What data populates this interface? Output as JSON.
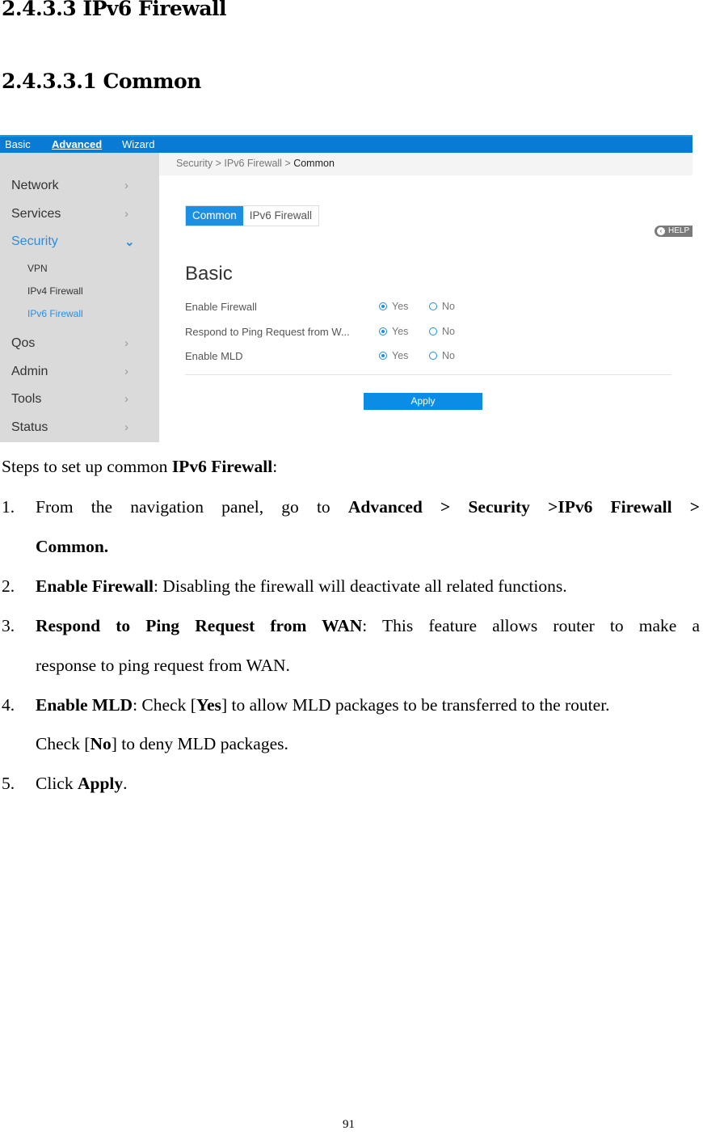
{
  "doc": {
    "heading1": "2.4.3.3 IPv6 Firewall",
    "heading2": "2.4.3.3.1 Common",
    "intro": {
      "prefix": "Steps to set up common ",
      "bold": "IPv6 Firewall",
      "suffix": ":"
    },
    "steps": [
      {
        "num": "1.",
        "line1": {
          "text": "From the navigation panel, go to ",
          "bold": "Advanced > Security >IPv6 Firewall >"
        },
        "line2_bold": "Common."
      },
      {
        "num": "2.",
        "bold": "Enable Firewall",
        "text": ": Disabling the firewall will deactivate all related functions."
      },
      {
        "num": "3.",
        "bold": "Respond to Ping Request from WAN",
        "text": ": This feature allows router to make a",
        "line2": "response to ping request from WAN."
      },
      {
        "num": "4.",
        "bold": "Enable MLD",
        "text_a": ": Check [",
        "bold_yes": "Yes",
        "text_b": "] to allow MLD packages to be transferred to the router.",
        "line2_a": "Check [",
        "bold_no": "No",
        "line2_b": "] to deny MLD packages."
      },
      {
        "num": "5.",
        "text": "Click ",
        "bold": "Apply",
        "suffix": "."
      }
    ],
    "page_number": "91"
  },
  "screenshot": {
    "topnav": [
      {
        "label": "Basic",
        "active": false
      },
      {
        "label": "Advanced",
        "active": true
      },
      {
        "label": "Wizard",
        "active": false
      }
    ],
    "breadcrumb": {
      "path": "Security > IPv6 Firewall > ",
      "current": "Common"
    },
    "sidebar": {
      "items": [
        {
          "label": "Network"
        },
        {
          "label": "Services"
        },
        {
          "label": "Security",
          "expanded": true
        },
        {
          "label": "Qos"
        },
        {
          "label": "Admin"
        },
        {
          "label": "Tools"
        },
        {
          "label": "Status"
        }
      ],
      "sub_items": [
        {
          "label": "VPN"
        },
        {
          "label": "IPv4 Firewall"
        },
        {
          "label": "IPv6 Firewall",
          "active": true
        }
      ]
    },
    "subtabs": [
      {
        "label": "Common",
        "active": true
      },
      {
        "label": "IPv6 Firewall",
        "active": false
      }
    ],
    "help_label": "HELP",
    "section_title": "Basic",
    "rows": [
      {
        "label": "Enable Firewall",
        "yes": "Yes",
        "no": "No",
        "selected": "Yes"
      },
      {
        "label": "Respond to Ping Request from W...",
        "yes": "Yes",
        "no": "No",
        "selected": "Yes"
      },
      {
        "label": "Enable MLD",
        "yes": "Yes",
        "no": "No",
        "selected": "Yes"
      }
    ],
    "apply_label": "Apply",
    "colors": {
      "accent": "#1a8fe3",
      "topbar": "#0a7bd4",
      "sidebar": "#dadada"
    }
  }
}
